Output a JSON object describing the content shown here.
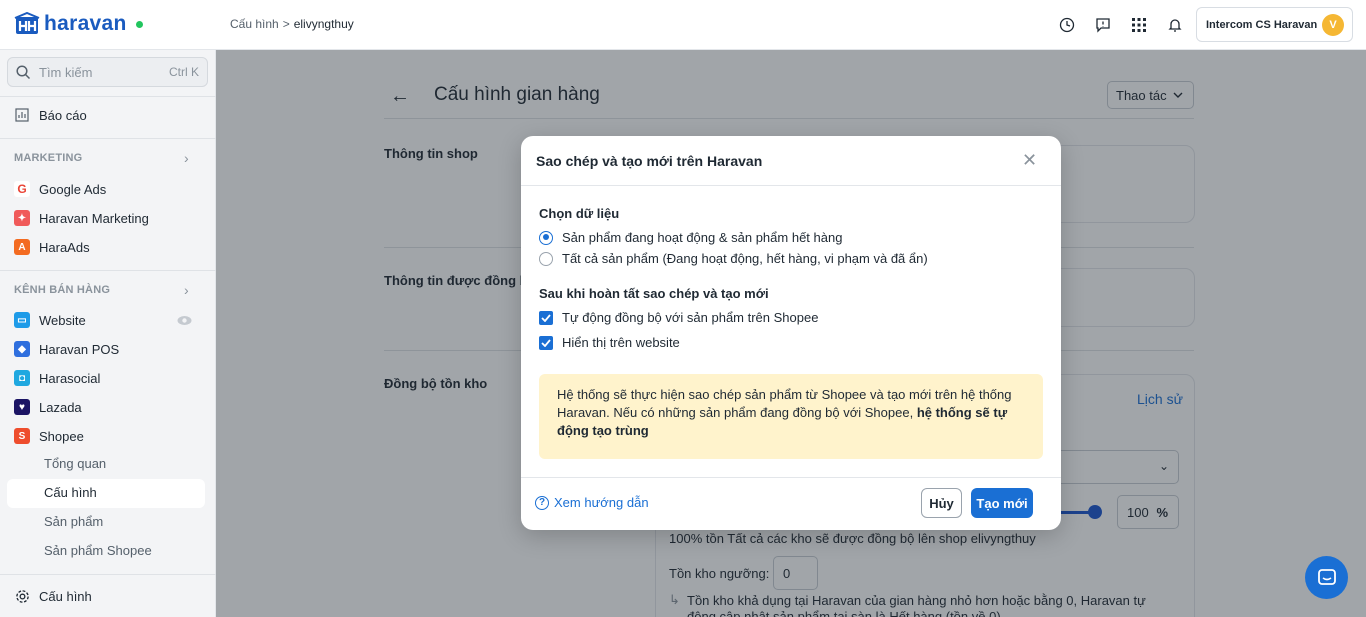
{
  "brand": {
    "name": "haravan",
    "accent": "#1a6fd4"
  },
  "breadcrumb": {
    "parent": "Cấu hình",
    "sep": ">",
    "current": "elivyngthuy"
  },
  "account": {
    "name": "Intercom CS Haravan",
    "initial": "V"
  },
  "sidebar": {
    "search_placeholder": "Tìm kiếm",
    "search_shortcut": "Ctrl K",
    "report": "Báo cáo",
    "marketing_section": "MARKETING",
    "marketing_items": [
      "Google Ads",
      "Haravan Marketing",
      "HaraAds"
    ],
    "channels_section": "KÊNH BÁN HÀNG",
    "channels": [
      "Website",
      "Haravan POS",
      "Harasocial",
      "Lazada",
      "Shopee"
    ],
    "shopee_sub": [
      "Tổng quan",
      "Cấu hình",
      "Sản phẩm",
      "Sản phẩm Shopee"
    ],
    "settings": "Cấu hình"
  },
  "page": {
    "title": "Cấu hình gian hàng",
    "actions_label": "Thao tác",
    "sections": [
      "Thông tin shop",
      "Thông tin được đồng b",
      "Đồng bộ tồn kho"
    ],
    "history_link": "Lịch sử",
    "percent_value": "100",
    "percent_unit": "%",
    "sync_desc": "100% tồn Tất cả các kho sẽ được đồng bộ lên shop elivyngthuy",
    "threshold_label": "Tồn kho ngưỡng:",
    "threshold_value": "0",
    "threshold_note_1": "Tồn kho khả dụng tại Haravan của gian hàng nhỏ hơn hoặc bằng 0, Haravan tự",
    "threshold_note_2": "động cập nhật sản phẩm tại sàn là Hết hàng (tồn về 0)"
  },
  "modal": {
    "title": "Sao chép và tạo mới trên Haravan",
    "data_label": "Chọn dữ liệu",
    "radio_options": [
      {
        "label": "Sản phẩm đang hoạt động & sản phẩm hết hàng",
        "selected": true
      },
      {
        "label": "Tất cả sản phẩm (Đang hoạt động, hết hàng, vi phạm và đã ẩn)",
        "selected": false
      }
    ],
    "after_label": "Sau khi hoàn tất sao chép và tạo mới",
    "checkboxes": [
      {
        "label": "Tự động đồng bộ với sản phẩm trên Shopee",
        "checked": true
      },
      {
        "label": "Hiển thị trên website",
        "checked": true
      }
    ],
    "notice_text": "Hệ thống sẽ thực hiện sao chép sản phẩm từ Shopee và tạo mới trên hệ thống Haravan. Nếu có những sản phẩm đang đồng bộ với Shopee, ",
    "notice_bold": "hệ thống sẽ tự động tạo trùng",
    "help_link": "Xem hướng dẫn",
    "cancel_label": "Hủy",
    "create_label": "Tạo mới"
  }
}
